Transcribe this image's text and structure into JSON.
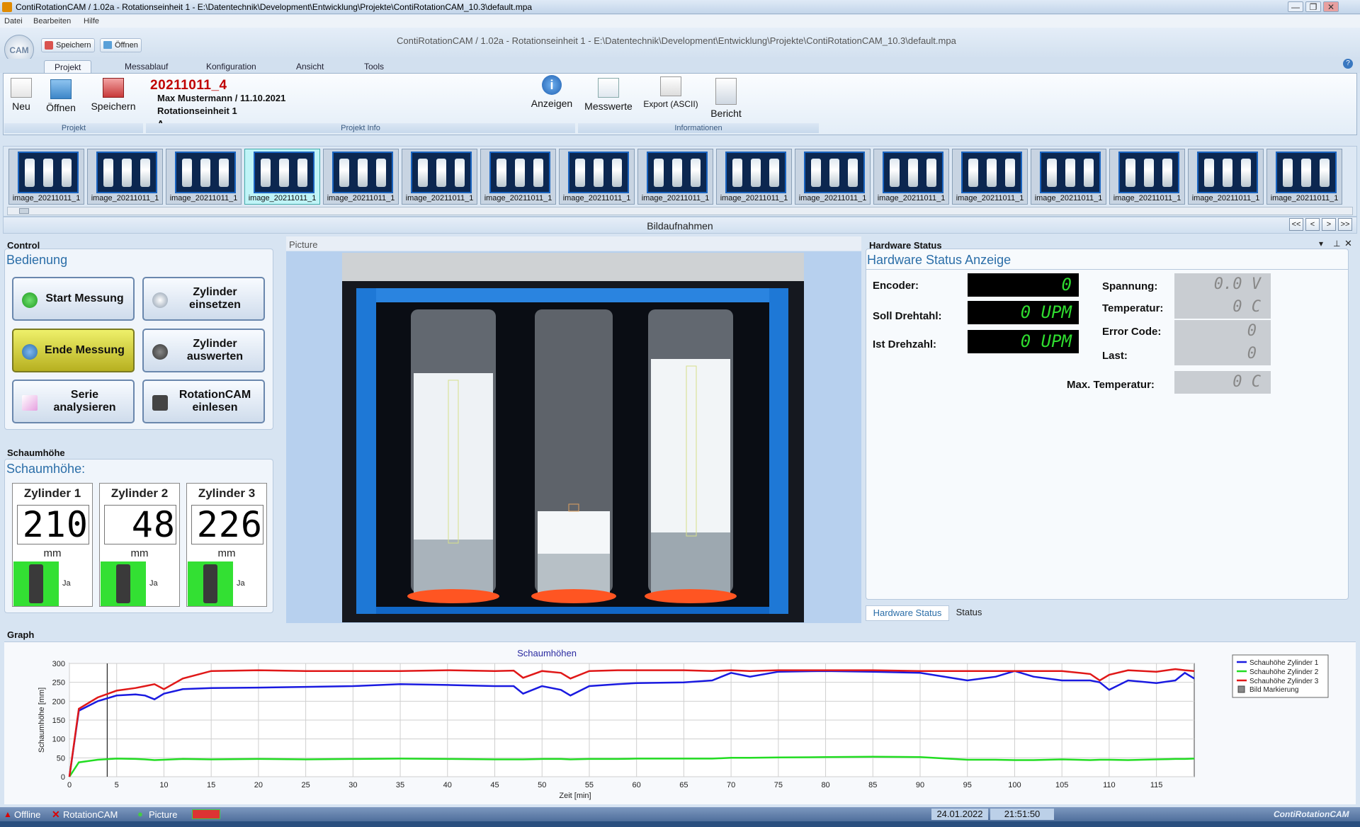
{
  "window": {
    "title": "ContiRotationCAM / 1.02a - Rotationseinheit 1 - E:\\Datentechnik\\Development\\Entwicklung\\Projekte\\ContiRotationCAM_10.3\\default.mpa",
    "doc_title": "ContiRotationCAM / 1.02a  -  Rotationseinheit 1  -  E:\\Datentechnik\\Development\\Entwicklung\\Projekte\\ContiRotationCAM_10.3\\default.mpa",
    "controls": [
      "—",
      "❐",
      "✕"
    ]
  },
  "menu": [
    "Datei",
    "Bearbeiten",
    "Hilfe"
  ],
  "app_button": "CAM",
  "quick_access": {
    "save": "Speichern",
    "open": "Öffnen"
  },
  "tabs": [
    "Projekt",
    "Messablauf",
    "Konfiguration",
    "Ansicht",
    "Tools"
  ],
  "ribbon": {
    "buttons": {
      "new": "Neu",
      "open": "Öffnen",
      "save": "Speichern",
      "show": "Anzeigen",
      "values": "Messwerte",
      "export": "Export (ASCII)",
      "report": "Bericht"
    },
    "groups": {
      "project": "Projekt",
      "project_info": "Projekt Info",
      "info": "Informationen"
    },
    "project_name": "20211011_4",
    "project_user": "Max Mustermann / 11.10.2021",
    "project_unit": "Rotationseinheit 1",
    "project_extra": "A"
  },
  "thumbnails": {
    "label": "image_20211011_1",
    "selected_index": 3,
    "title": "Bildaufnahmen",
    "nav": [
      "<<",
      "<",
      ">",
      ">>"
    ]
  },
  "control": {
    "panel_title": "Control",
    "heading": "Bedienung",
    "buttons": [
      "Start Messung",
      "Zylinder einsetzen",
      "Ende Messung",
      "Zylinder auswerten",
      "Serie analysieren",
      "RotationCAM einlesen"
    ]
  },
  "schaum": {
    "panel_title": "Schaumhöhe",
    "heading": "Schaumhöhe:",
    "unit": "mm",
    "status": "Ja",
    "cylinders": [
      {
        "name": "Zylinder 1",
        "value": "210"
      },
      {
        "name": "Zylinder 2",
        "value": "48"
      },
      {
        "name": "Zylinder 3",
        "value": "226"
      }
    ]
  },
  "picture": {
    "panel_title": "Picture"
  },
  "hardware": {
    "panel_title": "Hardware Status",
    "heading": "Hardware Status Anzeige",
    "encoder_label": "Encoder:",
    "encoder_value": "0",
    "soll_label": "Soll Drehtahl:",
    "soll_value": "0 UPM",
    "ist_label": "Ist Drehzahl:",
    "ist_value": "0 UPM",
    "spannung_label": "Spannung:",
    "spannung_value": "0.0 V",
    "temp_label": "Temperatur:",
    "temp_value": "0  C",
    "error_label": "Error Code:",
    "error_value": "0",
    "last_label": "Last:",
    "last_value": "0",
    "maxtemp_label": "Max. Temperatur:",
    "maxtemp_value": "0  C",
    "tabs": [
      "Hardware Status",
      "Status"
    ]
  },
  "graph": {
    "panel_title": "Graph"
  },
  "statusbar": {
    "offline": "Offline",
    "rotationcam": "RotationCAM",
    "picture": "Picture",
    "date": "24.01.2022",
    "time": "21:51:50",
    "brand": "ContiRotationCAM"
  },
  "colors": {
    "series1": "#1a1ae0",
    "series2": "#22dd22",
    "series3": "#e01818",
    "lcd_text": "#2fdc2f",
    "project_name": "#c00000",
    "heading_blue": "#2b6ea8"
  },
  "chart_data": {
    "type": "line",
    "title": "Schaumhöhen",
    "xlabel": "Zeit [min]",
    "ylabel": "Schaumhöhe [mm]",
    "xlim": [
      0,
      119
    ],
    "ylim": [
      0,
      300
    ],
    "xticks": [
      0,
      5,
      10,
      15,
      20,
      25,
      30,
      35,
      40,
      45,
      50,
      55,
      60,
      65,
      70,
      75,
      80,
      85,
      90,
      95,
      100,
      105,
      110,
      115
    ],
    "yticks": [
      0,
      50,
      100,
      150,
      200,
      250,
      300
    ],
    "grid": true,
    "legend_position": "top-right",
    "marker_line_x": 4,
    "legend_marker": "Bild Markierung",
    "x": [
      0,
      1,
      3,
      5,
      7,
      8,
      9,
      10,
      12,
      15,
      20,
      25,
      30,
      35,
      40,
      45,
      47,
      48,
      50,
      52,
      53,
      55,
      58,
      60,
      65,
      68,
      70,
      72,
      75,
      80,
      85,
      90,
      95,
      98,
      100,
      102,
      105,
      108,
      109,
      110,
      112,
      115,
      117,
      118,
      119
    ],
    "series": [
      {
        "name": "Schauhöhe Zylinder 1",
        "values": [
          0,
          175,
          200,
          215,
          218,
          215,
          205,
          220,
          232,
          235,
          236,
          238,
          240,
          245,
          243,
          240,
          240,
          220,
          240,
          230,
          215,
          240,
          245,
          248,
          250,
          255,
          275,
          265,
          278,
          280,
          278,
          275,
          255,
          265,
          280,
          265,
          255,
          255,
          250,
          230,
          255,
          248,
          255,
          275,
          260
        ]
      },
      {
        "name": "Schauhöhe Zylinder 2",
        "values": [
          0,
          38,
          45,
          48,
          47,
          46,
          44,
          45,
          47,
          46,
          47,
          46,
          47,
          48,
          47,
          46,
          46,
          46,
          47,
          47,
          46,
          47,
          47,
          48,
          48,
          48,
          50,
          50,
          51,
          52,
          53,
          52,
          45,
          45,
          44,
          44,
          46,
          44,
          45,
          45,
          44,
          46,
          47,
          47,
          48
        ]
      },
      {
        "name": "Schauhöhe Zylinder 3",
        "values": [
          0,
          180,
          210,
          228,
          235,
          240,
          245,
          232,
          260,
          280,
          282,
          280,
          280,
          280,
          282,
          280,
          281,
          262,
          280,
          275,
          260,
          280,
          282,
          282,
          282,
          280,
          282,
          280,
          282,
          282,
          282,
          280,
          280,
          280,
          280,
          280,
          280,
          272,
          255,
          270,
          282,
          278,
          285,
          282,
          280
        ]
      }
    ]
  }
}
